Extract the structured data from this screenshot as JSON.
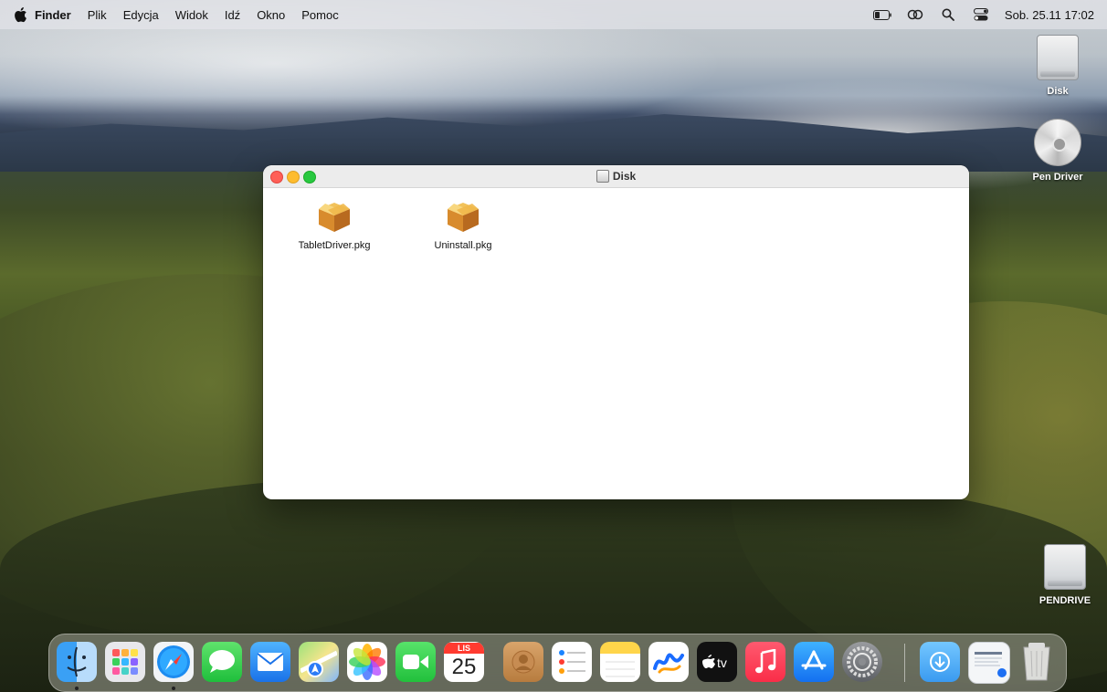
{
  "menubar": {
    "app_name": "Finder",
    "items": [
      "Plik",
      "Edycja",
      "Widok",
      "Idź",
      "Okno",
      "Pomoc"
    ],
    "datetime": "Sob. 25.11 17:02"
  },
  "desktop_icons": [
    {
      "label": "Disk"
    },
    {
      "label": "Pen Driver"
    },
    {
      "label": "PENDRIVE"
    }
  ],
  "window": {
    "title": "Disk",
    "files": [
      {
        "name": "TabletDriver.pkg"
      },
      {
        "name": "Uninstall.pkg"
      }
    ]
  },
  "dock": {
    "calendar": {
      "month": "LIS",
      "day": "25"
    },
    "apps": [
      "finder",
      "launchpad",
      "safari",
      "messages",
      "mail",
      "maps",
      "photos",
      "facetime",
      "calendar",
      "contacts",
      "reminders",
      "notes",
      "freeform",
      "tv",
      "music",
      "app-store",
      "system-settings",
      "downloads",
      "recent-document",
      "trash"
    ]
  },
  "colors": {
    "close": "#ff5f57",
    "minimize": "#febc2e",
    "zoom": "#28c840"
  }
}
